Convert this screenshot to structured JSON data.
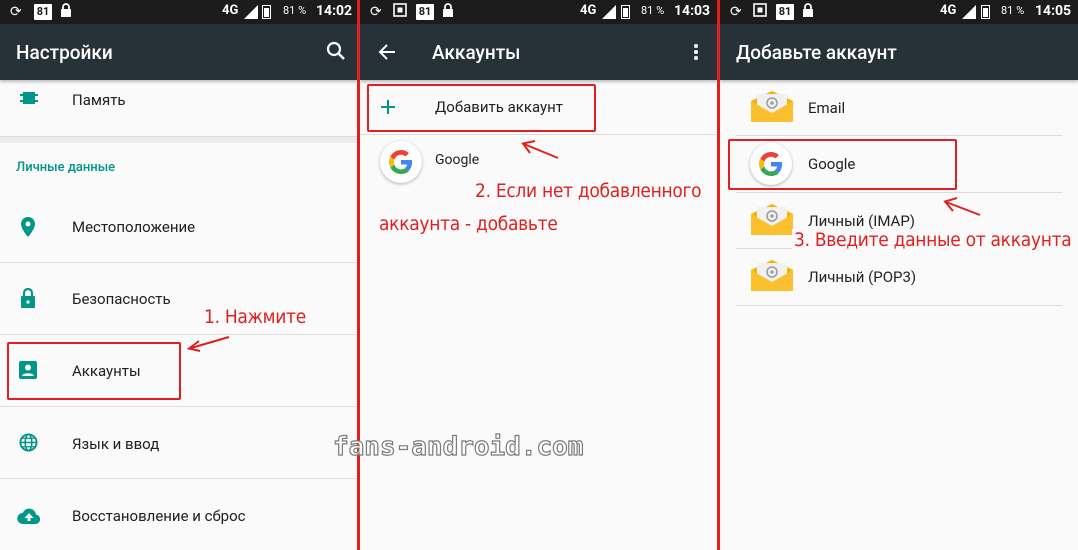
{
  "status": [
    {
      "notif": "81",
      "network": "4G",
      "battery": "81 %",
      "time": "14:02"
    },
    {
      "notif": "81",
      "network": "4G",
      "battery": "81 %",
      "time": "14:03"
    },
    {
      "notif": "81",
      "network": "4G",
      "battery": "81 %",
      "time": "14:05"
    }
  ],
  "screen1": {
    "title": "Настройки",
    "top_item": "Память",
    "section_header": "Личные данные",
    "items": [
      {
        "label": "Местоположение",
        "icon": "location-icon"
      },
      {
        "label": "Безопасность",
        "icon": "lock-icon"
      },
      {
        "label": "Аккаунты",
        "icon": "account-box-icon"
      },
      {
        "label": "Язык и ввод",
        "icon": "globe-icon"
      },
      {
        "label": "Восстановление и сброс",
        "icon": "cloud-upload-icon"
      }
    ],
    "annotation": "1. Нажмите"
  },
  "screen2": {
    "title": "Аккаунты",
    "add_label": "Добавить аккаунт",
    "google_label": "Google",
    "annotation_line1": "2. Если нет добавленного",
    "annotation_line2": "аккаунта - добавьте"
  },
  "screen3": {
    "title": "Добавьте аккаунт",
    "items": [
      {
        "label": "Email",
        "icon": "email-envelope-icon"
      },
      {
        "label": "Google",
        "icon": "google-icon"
      },
      {
        "label": "Личный (IMAP)",
        "icon": "email-envelope-icon"
      },
      {
        "label": "Личный (POP3)",
        "icon": "email-envelope-icon"
      }
    ],
    "annotation": "3. Введите данные от аккаунта"
  },
  "watermark": "fans-android.com",
  "colors": {
    "appbar": "#263238",
    "accent": "#009688",
    "annotation": "#e02020"
  }
}
